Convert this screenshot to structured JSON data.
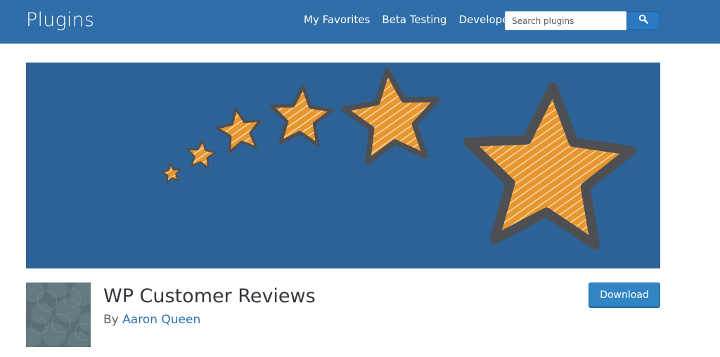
{
  "header": {
    "brand": "Plugins",
    "nav": [
      "My Favorites",
      "Beta Testing",
      "Developers"
    ],
    "search": {
      "placeholder": "Search plugins",
      "value": "",
      "button_icon": "search-icon"
    },
    "colors": {
      "bar": "#2f6ea8",
      "button": "#2a79c1"
    }
  },
  "banner": {
    "background": "#2d6296",
    "star_fill": "#e8962f",
    "star_outline": "#4d4f52",
    "star_count": 6
  },
  "plugin": {
    "title": "WP Customer Reviews",
    "by_label": "By",
    "author": "Aaron Queen",
    "download_label": "Download",
    "author_color": "#2b74b8"
  }
}
